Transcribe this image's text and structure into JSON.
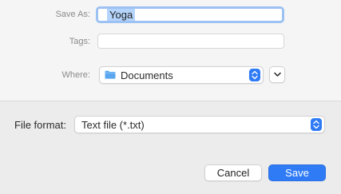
{
  "dialog": {
    "save_as": {
      "label": "Save As:",
      "value": "Yoga"
    },
    "tags": {
      "label": "Tags:",
      "value": ""
    },
    "where": {
      "label": "Where:",
      "value": "Documents",
      "icon": "folder-icon"
    },
    "file_format": {
      "label": "File format:",
      "value": "Text file (*.txt)"
    },
    "buttons": {
      "cancel": "Cancel",
      "save": "Save"
    }
  },
  "colors": {
    "accent": "#2f7bf6",
    "selection": "#b4d4fb",
    "focus_ring": "#9cc1f3",
    "folder": "#5aa7f0"
  }
}
